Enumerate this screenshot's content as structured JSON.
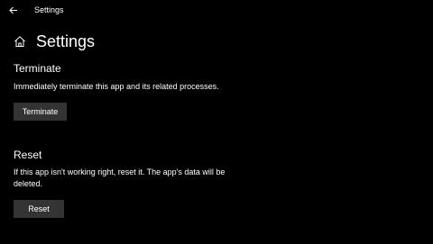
{
  "window": {
    "title": "Settings"
  },
  "header": {
    "title": "Settings"
  },
  "terminate": {
    "heading": "Terminate",
    "description": "Immediately terminate this app and its related processes.",
    "button_label": "Terminate"
  },
  "reset": {
    "heading": "Reset",
    "description_line1": "If this app isn't working right, reset it. The app's data will be",
    "description_line2": "deleted.",
    "button_label": "Reset"
  },
  "icons": {
    "back": "back-arrow-icon",
    "home": "home-icon"
  },
  "colors": {
    "background": "#000000",
    "text": "#ffffff",
    "button": "#333333"
  }
}
